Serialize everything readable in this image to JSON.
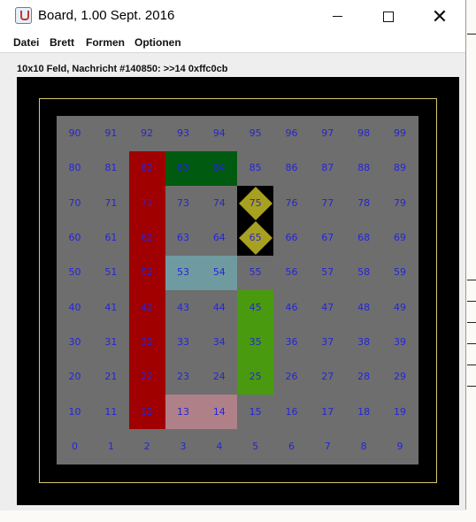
{
  "window": {
    "title": "Board, 1.00 Sept. 2016",
    "controls": [
      "minimize",
      "maximize",
      "close"
    ]
  },
  "menu": [
    "Datei",
    "Brett",
    "Formen",
    "Optionen"
  ],
  "status": "10x10 Feld, Nachricht #140850: >>14 0xffc0cb",
  "board": {
    "rows": 10,
    "cols": 10,
    "numbers": [
      [
        "90",
        "91",
        "92",
        "93",
        "94",
        "95",
        "96",
        "97",
        "98",
        "99"
      ],
      [
        "80",
        "81",
        "82",
        "83",
        "84",
        "85",
        "86",
        "87",
        "88",
        "89"
      ],
      [
        "70",
        "71",
        "72",
        "73",
        "74",
        "75",
        "76",
        "77",
        "78",
        "79"
      ],
      [
        "60",
        "61",
        "62",
        "63",
        "64",
        "65",
        "66",
        "67",
        "68",
        "69"
      ],
      [
        "50",
        "51",
        "52",
        "53",
        "54",
        "55",
        "56",
        "57",
        "58",
        "59"
      ],
      [
        "40",
        "41",
        "42",
        "43",
        "44",
        "45",
        "46",
        "47",
        "48",
        "49"
      ],
      [
        "30",
        "31",
        "32",
        "33",
        "34",
        "35",
        "36",
        "37",
        "38",
        "39"
      ],
      [
        "20",
        "21",
        "22",
        "23",
        "24",
        "25",
        "26",
        "27",
        "28",
        "29"
      ],
      [
        "10",
        "11",
        "12",
        "13",
        "14",
        "15",
        "16",
        "17",
        "18",
        "19"
      ],
      [
        "0",
        "1",
        "2",
        "3",
        "4",
        "5",
        "6",
        "7",
        "8",
        "9"
      ]
    ],
    "colors": {
      "background": "#6e6e6e",
      "red": "#a00000",
      "darkgreen": "#005a10",
      "lightblue": "#6f9aa0",
      "green": "#4a9a10",
      "pink": "#b08088",
      "black": "#000000",
      "diamond": "#a8a020",
      "label": "#2525d8"
    },
    "regions": [
      {
        "name": "red-column",
        "color": "red",
        "fields": [
          "12",
          "22",
          "32",
          "42",
          "52",
          "62",
          "72",
          "82"
        ]
      },
      {
        "name": "darkgreen-block",
        "color": "darkgreen",
        "fields": [
          "83",
          "84"
        ]
      },
      {
        "name": "lightblue-block",
        "color": "lightblue",
        "fields": [
          "53",
          "54"
        ]
      },
      {
        "name": "green-column",
        "color": "green",
        "fields": [
          "25",
          "35",
          "45"
        ]
      },
      {
        "name": "pink-block",
        "color": "pink",
        "fields": [
          "13",
          "14"
        ]
      },
      {
        "name": "black-cells",
        "color": "black",
        "fields": [
          "65",
          "75"
        ]
      }
    ],
    "diamonds": [
      "65",
      "75"
    ]
  }
}
